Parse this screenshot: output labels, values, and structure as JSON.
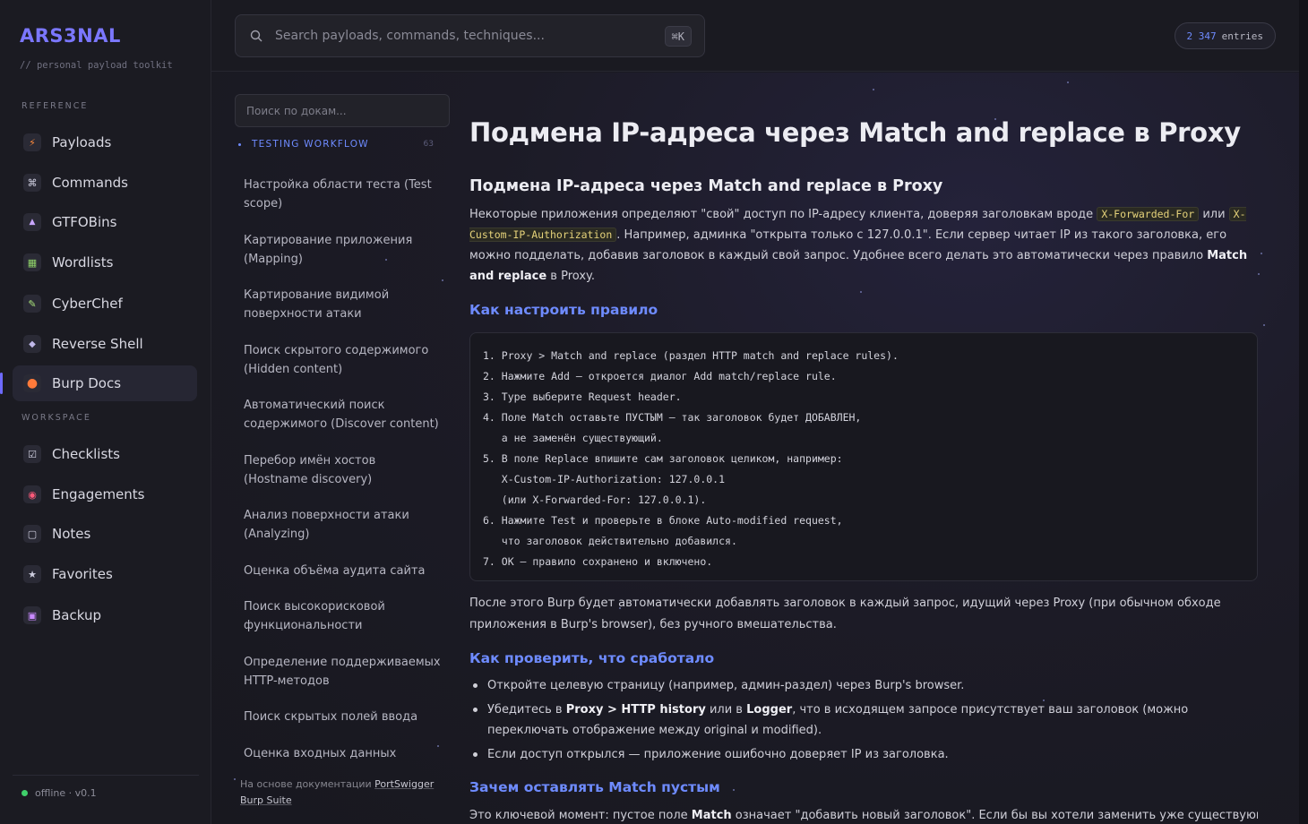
{
  "brand": {
    "name": "ARS3NAL",
    "tagline": "// personal payload toolkit"
  },
  "sidebar": {
    "reference_label": "REFERENCE",
    "workspace_label": "WORKSPACE",
    "reference_items": [
      {
        "label": "Payloads",
        "icon": "⚡"
      },
      {
        "label": "Commands",
        "icon": "⌘"
      },
      {
        "label": "GTFOBins",
        "icon": "▲"
      },
      {
        "label": "Wordlists",
        "icon": "▦"
      },
      {
        "label": "CyberChef",
        "icon": "✎"
      },
      {
        "label": "Reverse Shell",
        "icon": "◆"
      },
      {
        "label": "Burp Docs",
        "icon": "●"
      }
    ],
    "workspace_items": [
      {
        "label": "Checklists",
        "icon": "☑"
      },
      {
        "label": "Engagements",
        "icon": "◉"
      },
      {
        "label": "Notes",
        "icon": "▢"
      },
      {
        "label": "Favorites",
        "icon": "★"
      },
      {
        "label": "Backup",
        "icon": "▣"
      }
    ],
    "active_item": "Burp Docs",
    "status": "offline · v0.1"
  },
  "topbar": {
    "search_placeholder": "Search payloads, commands, techniques...",
    "shortcut": "⌘K",
    "entries_count": "2 347",
    "entries_label": "entries"
  },
  "docs_nav": {
    "search_placeholder": "Поиск по докам...",
    "group_label": "TESTING WORKFLOW",
    "group_count": "63",
    "items": [
      "Настройка области теста (Test scope)",
      "Картирование приложения (Mapping)",
      "Картирование видимой поверхности атаки",
      "Поиск скрытого содержимого (Hidden content)",
      "Автоматический поиск содержимого (Discover content)",
      "Перебор имён хостов (Hostname discovery)",
      "Анализ поверхности атаки (Analyzing)",
      "Оценка объёма аудита сайта",
      "Поиск высокорисковой функциональности",
      "Определение поддерживаемых HTTP-методов",
      "Поиск скрытых полей ввода",
      "Оценка входных данных (Evaluating inputs)"
    ],
    "credit_prefix": "На основе документации",
    "credit_link": "PortSwigger Burp Suite"
  },
  "article": {
    "title": "Подмена IP-адреса через Match and replace в Proxy",
    "subtitle": "Подмена IP-адреса через Match and replace в Proxy",
    "intro_1": "Некоторые приложения определяют \"свой\" доступ по IP-адресу клиента, доверяя заголовкам вроде",
    "code_1": "X-Forwarded-For",
    "intro_or": "или",
    "code_2": "X-Custom-IP-Authorization",
    "intro_2": ". Например, админка \"открыта только с 127.0.0.1\". Если сервер читает IP из такого заголовка, его можно подделать, добавив заголовок в каждый свой запрос. Удобнее всего делать это автоматически через правило",
    "intro_bold": "Match and replace",
    "intro_3": "в Proxy.",
    "h_setup": "Как настроить правило",
    "code_lines": [
      "1. Proxy > Match and replace (раздел HTTP match and replace rules).",
      "2. Нажмите Add — откроется диалог Add match/replace rule.",
      "3. Type выберите Request header.",
      "4. Поле Match оставьте ПУСТЫМ — так заголовок будет ДОБАВЛЕН,",
      "   а не заменён существующий.",
      "5. В поле Replace впишите сам заголовок целиком, например:",
      "   X-Custom-IP-Authorization: 127.0.0.1",
      "   (или X-Forwarded-For: 127.0.0.1).",
      "6. Нажмите Test и проверьте в блоке Auto-modified request,",
      "   что заголовок действительно добавился.",
      "7. OK — правило сохранено и включено."
    ],
    "after_code": "После этого Burp будет автоматически добавлять заголовок в каждый запрос, идущий через Proxy (при обычном обходе приложения в Burp's browser), без ручного вмешательства.",
    "h_verify": "Как проверить, что сработало",
    "verify_1": "Откройте целевую страницу (например, админ-раздел) через Burp's browser.",
    "verify_2_a": "Убедитесь в",
    "verify_2_b1": "Proxy > HTTP history",
    "verify_2_c": "или в",
    "verify_2_b2": "Logger",
    "verify_2_d": ", что в исходящем запросе присутствует ваш заголовок (можно переключать отображение между original и modified).",
    "verify_3": "Если доступ открылся — приложение ошибочно доверяет IP из заголовка.",
    "h_why": "Зачем оставлять Match пустым",
    "why_a": "Это ключевой момент: пустое поле",
    "why_b": "Match",
    "why_c": "означает \"добавить новый заголовок\". Если бы вы хотели заменить уже существующий"
  }
}
